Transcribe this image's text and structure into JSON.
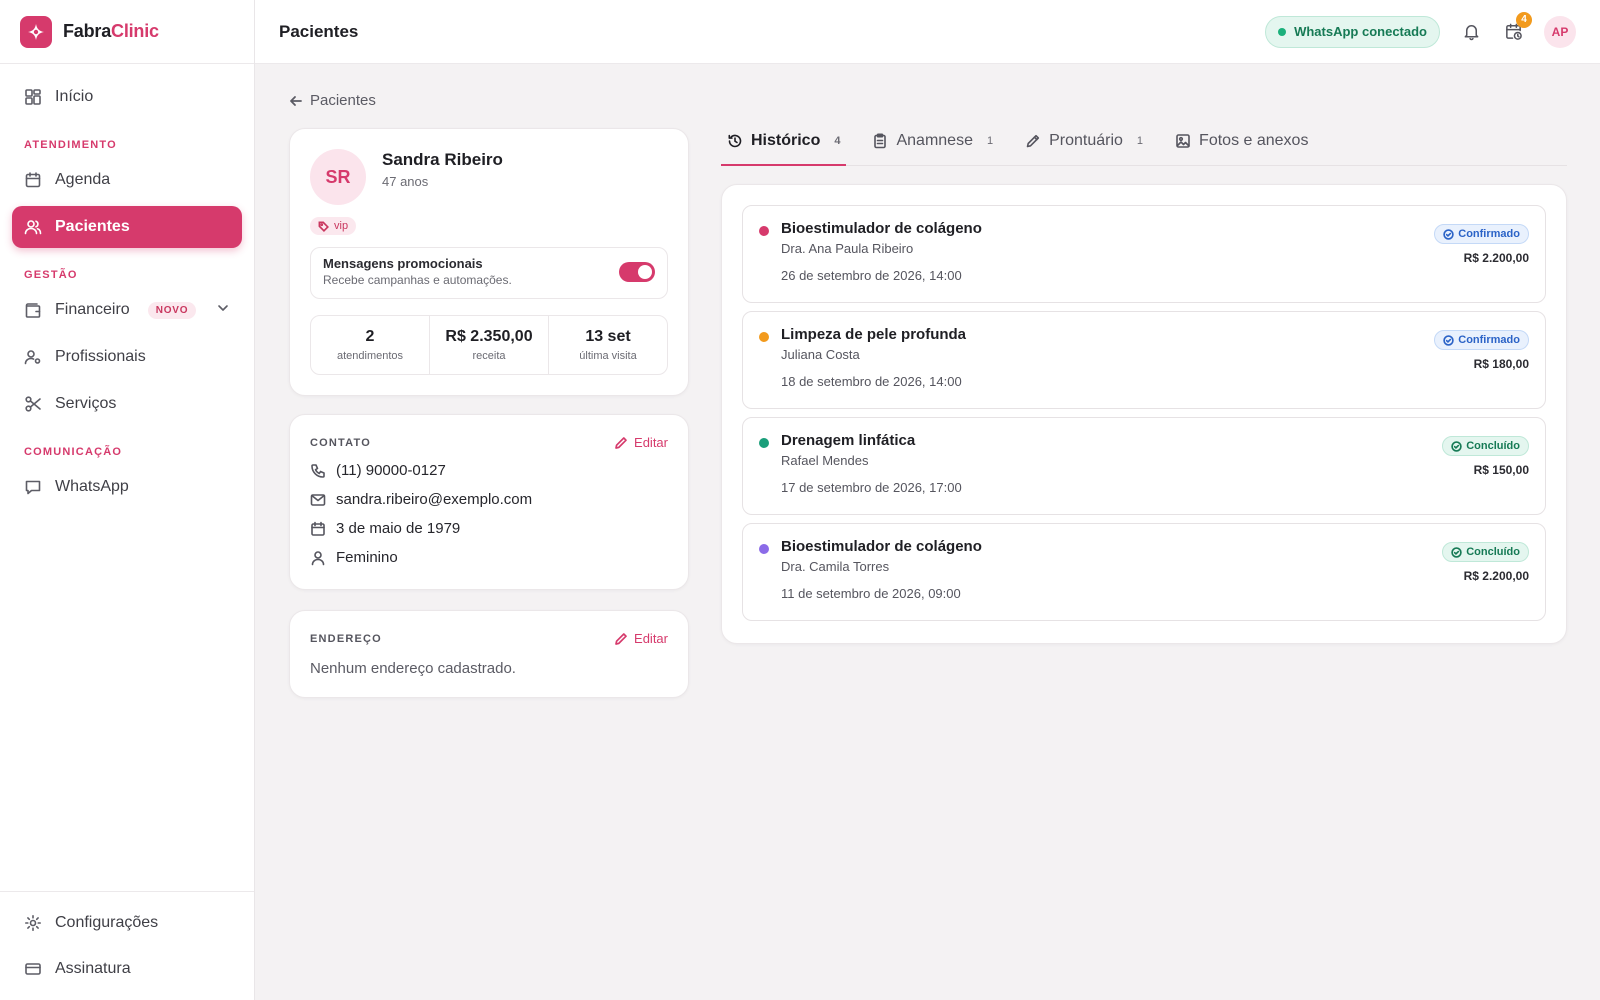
{
  "brand": {
    "name_part1": "Fabra",
    "name_part2": "Clinic",
    "accent_color": "#d63a6c"
  },
  "sidebar": {
    "items_top": [
      {
        "label": "Início",
        "icon": "grid-icon"
      }
    ],
    "sections": [
      {
        "title": "ATENDIMENTO",
        "items": [
          {
            "label": "Agenda",
            "icon": "calendar-icon"
          },
          {
            "label": "Pacientes",
            "icon": "users-icon",
            "active": true
          }
        ]
      },
      {
        "title": "GESTÃO",
        "items": [
          {
            "label": "Financeiro",
            "icon": "wallet-icon",
            "badge": "NOVO"
          },
          {
            "label": "Profissionais",
            "icon": "user-cog-icon"
          },
          {
            "label": "Serviços",
            "icon": "scissors-icon"
          }
        ]
      },
      {
        "title": "COMUNICAÇÃO",
        "items": [
          {
            "label": "WhatsApp",
            "icon": "message-icon"
          }
        ]
      }
    ],
    "bottom_items": [
      {
        "label": "Configurações",
        "icon": "gear-icon"
      },
      {
        "label": "Assinatura",
        "icon": "credit-card-icon"
      }
    ]
  },
  "header": {
    "title": "Pacientes",
    "whatsapp_status": "WhatsApp conectado",
    "calendar_badge": "4",
    "user_initials": "AP"
  },
  "breadcrumb": {
    "back_label": "Pacientes"
  },
  "patient": {
    "initials": "SR",
    "name": "Sandra Ribeiro",
    "age": "47 anos",
    "tag": "vip",
    "promo_title": "Mensagens promocionais",
    "promo_subtitle": "Recebe campanhas e automações.",
    "promo_enabled": true,
    "stats": [
      {
        "value": "2",
        "label": "atendimentos"
      },
      {
        "value": "R$ 2.350,00",
        "label": "receita"
      },
      {
        "value": "13 set",
        "label": "última visita"
      }
    ]
  },
  "contact": {
    "title": "CONTATO",
    "edit_label": "Editar",
    "phone": "(11) 90000-0127",
    "email": "sandra.ribeiro@exemplo.com",
    "birthdate": "3 de maio de 1979",
    "gender": "Feminino"
  },
  "address": {
    "title": "ENDEREÇO",
    "edit_label": "Editar",
    "empty_text": "Nenhum endereço cadastrado."
  },
  "tabs": [
    {
      "label": "Histórico",
      "count": "4",
      "icon": "history-icon",
      "active": true
    },
    {
      "label": "Anamnese",
      "count": "1",
      "icon": "clipboard-icon"
    },
    {
      "label": "Prontuário",
      "count": "1",
      "icon": "pen-icon"
    },
    {
      "label": "Fotos e anexos",
      "count": "",
      "icon": "image-icon"
    }
  ],
  "history": [
    {
      "service": "Bioestimulador de colágeno",
      "professional": "Dra. Ana Paula Ribeiro",
      "datetime": "26 de setembro de 2026, 14:00",
      "status": "Confirmado",
      "price": "R$ 2.200,00",
      "dot_color": "#d63a6c"
    },
    {
      "service": "Limpeza de pele profunda",
      "professional": "Juliana Costa",
      "datetime": "18 de setembro de 2026, 14:00",
      "status": "Confirmado",
      "price": "R$ 180,00",
      "dot_color": "#f29a1d"
    },
    {
      "service": "Drenagem linfática",
      "professional": "Rafael Mendes",
      "datetime": "17 de setembro de 2026, 17:00",
      "status": "Concluído",
      "price": "R$ 150,00",
      "dot_color": "#1a9e7a"
    },
    {
      "service": "Bioestimulador de colágeno",
      "professional": "Dra. Camila Torres",
      "datetime": "11 de setembro de 2026, 09:00",
      "status": "Concluído",
      "price": "R$ 2.200,00",
      "dot_color": "#8b6be8"
    }
  ]
}
